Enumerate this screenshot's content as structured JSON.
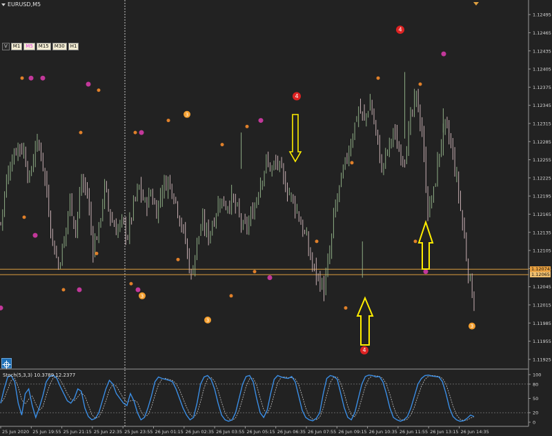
{
  "symbol": "EURUSD,M5",
  "timeframes": [
    {
      "label": "V"
    },
    {
      "label": "M1"
    },
    {
      "label": "M5",
      "active": true
    },
    {
      "label": "M15"
    },
    {
      "label": "M30"
    },
    {
      "label": "H1"
    }
  ],
  "indicator_label": "Stoch(5,3,3) 10.3789 12.2377",
  "price_axis": [
    "1.12495",
    "1.12465",
    "1.12435",
    "1.12405",
    "1.12375",
    "1.12345",
    "1.12315",
    "1.12285",
    "1.12255",
    "1.12225",
    "1.12195",
    "1.12165",
    "1.12135",
    "1.12105",
    "1.12075",
    "1.12045",
    "1.12015",
    "1.11985",
    "1.11955",
    "1.11925"
  ],
  "price_tags": {
    "upper": "1.12074",
    "lower": "1.12065"
  },
  "stoch_axis": [
    "100",
    "80",
    "50",
    "20",
    "0"
  ],
  "time_axis": [
    "25 Jun 2020",
    "25 Jun 19:55",
    "25 Jun 21:15",
    "25 Jun 22:35",
    "25 Jun 23:55",
    "26 Jun 01:15",
    "26 Jun 02:35",
    "26 Jun 03:55",
    "26 Jun 05:15",
    "26 Jun 06:35",
    "26 Jun 07:55",
    "26 Jun 09:15",
    "26 Jun 10:35",
    "26 Jun 11:55",
    "26 Jun 13:15",
    "26 Jun 14:35"
  ],
  "colors": {
    "background": "#222222",
    "bull_candle": "#8fae86",
    "bear_candle": "#c9b0b4",
    "level_line": "#e0a040",
    "arrow": "#ffee00",
    "stoch_main": "#3a8ee6",
    "stoch_signal": "#c8c8c8",
    "marker_pink": "#c2389a",
    "marker_orange": "#e0802a",
    "marker_red": "#dd2222",
    "marker_yellow_orange": "#f5a030"
  },
  "chart_data": {
    "type": "candlestick",
    "symbol": "EURUSD",
    "timeframe": "M5",
    "y_range": [
      1.1191,
      1.1251
    ],
    "level_lines": [
      1.12074,
      1.12065
    ],
    "close_path": [
      [
        0,
        1.1215
      ],
      [
        3,
        1.1222
      ],
      [
        6,
        1.1226
      ],
      [
        9,
        1.1228
      ],
      [
        12,
        1.1227
      ],
      [
        15,
        1.1222
      ],
      [
        18,
        1.1228
      ],
      [
        21,
        1.1227
      ],
      [
        24,
        1.122
      ],
      [
        27,
        1.1212
      ],
      [
        30,
        1.1208
      ],
      [
        33,
        1.1212
      ],
      [
        36,
        1.1219
      ],
      [
        39,
        1.1214
      ],
      [
        42,
        1.1222
      ],
      [
        45,
        1.122
      ],
      [
        48,
        1.1211
      ],
      [
        51,
        1.1214
      ],
      [
        54,
        1.1221
      ],
      [
        57,
        1.1216
      ],
      [
        60,
        1.1214
      ],
      [
        63,
        1.1215
      ],
      [
        66,
        1.1213
      ],
      [
        69,
        1.1218
      ],
      [
        72,
        1.1221
      ],
      [
        75,
        1.1218
      ],
      [
        78,
        1.122
      ],
      [
        81,
        1.1217
      ],
      [
        84,
        1.1221
      ],
      [
        87,
        1.1222
      ],
      [
        90,
        1.122
      ],
      [
        93,
        1.1216
      ],
      [
        96,
        1.1212
      ],
      [
        99,
        1.1206
      ],
      [
        102,
        1.1212
      ],
      [
        105,
        1.1215
      ],
      [
        108,
        1.1213
      ],
      [
        111,
        1.1216
      ],
      [
        114,
        1.1219
      ],
      [
        117,
        1.1218
      ],
      [
        120,
        1.1219
      ],
      [
        123,
        1.1217
      ],
      [
        126,
        1.1214
      ],
      [
        129,
        1.1215
      ],
      [
        132,
        1.1218
      ],
      [
        135,
        1.1222
      ],
      [
        138,
        1.1225
      ],
      [
        141,
        1.1224
      ],
      [
        144,
        1.1225
      ],
      [
        147,
        1.1222
      ],
      [
        150,
        1.122
      ],
      [
        153,
        1.1218
      ],
      [
        156,
        1.1215
      ],
      [
        159,
        1.1212
      ],
      [
        162,
        1.1208
      ],
      [
        165,
        1.1206
      ],
      [
        168,
        1.1204
      ],
      [
        171,
        1.121
      ],
      [
        174,
        1.1218
      ],
      [
        177,
        1.1222
      ],
      [
        180,
        1.1226
      ],
      [
        183,
        1.123
      ],
      [
        186,
        1.1234
      ],
      [
        189,
        1.1232
      ],
      [
        192,
        1.1235
      ],
      [
        195,
        1.123
      ],
      [
        198,
        1.1224
      ],
      [
        201,
        1.1227
      ],
      [
        204,
        1.123
      ],
      [
        207,
        1.1227
      ],
      [
        210,
        1.1226
      ],
      [
        213,
        1.1232
      ],
      [
        216,
        1.1236
      ],
      [
        219,
        1.123
      ],
      [
        222,
        1.1217
      ],
      [
        225,
        1.122
      ],
      [
        228,
        1.1227
      ],
      [
        231,
        1.1231
      ],
      [
        234,
        1.1228
      ],
      [
        237,
        1.1222
      ],
      [
        240,
        1.1215
      ],
      [
        243,
        1.1207
      ],
      [
        246,
        1.1202
      ]
    ],
    "annotations": [
      {
        "type": "arrow_down",
        "label": "yellow down arrow above high"
      },
      {
        "type": "arrow_up",
        "label": "yellow up arrow below low"
      },
      {
        "type": "arrow_up",
        "label": "yellow up arrow below pullback"
      }
    ]
  },
  "stoch_data": {
    "range": [
      0,
      100
    ],
    "main": [
      40,
      70,
      95,
      98,
      85,
      40,
      15,
      60,
      70,
      35,
      10,
      30,
      55,
      85,
      96,
      99,
      92,
      75,
      60,
      45,
      40,
      50,
      70,
      65,
      30,
      12,
      5,
      8,
      20,
      45,
      70,
      88,
      80,
      60,
      50,
      40,
      35,
      60,
      45,
      20,
      5,
      10,
      30,
      55,
      85,
      95,
      92,
      90,
      88,
      85,
      70,
      50,
      30,
      15,
      5,
      10,
      40,
      80,
      95,
      98,
      90,
      70,
      40,
      15,
      5,
      2,
      5,
      20,
      50,
      80,
      96,
      98,
      85,
      50,
      20,
      10,
      25,
      60,
      90,
      98,
      95,
      93,
      92,
      96,
      85,
      55,
      25,
      10,
      5,
      3,
      8,
      20,
      60,
      92,
      98,
      96,
      90,
      60,
      30,
      10,
      5,
      20,
      50,
      80,
      96,
      99,
      98,
      95,
      96,
      85,
      60,
      30,
      10,
      5,
      2,
      5,
      12,
      30,
      55,
      80,
      92,
      98,
      99,
      97,
      96,
      95,
      85,
      60,
      30,
      12,
      5,
      2,
      3,
      8,
      15,
      12
    ]
  }
}
